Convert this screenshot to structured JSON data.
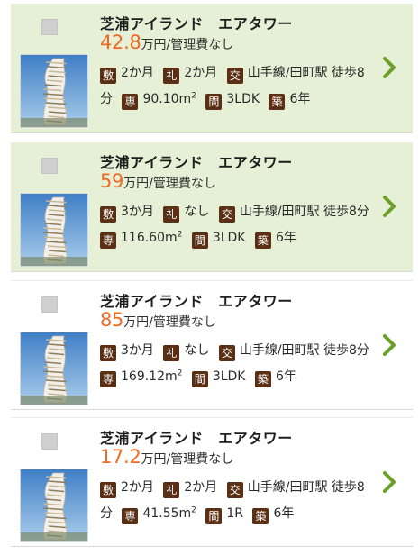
{
  "colors": {
    "price": "#ef6a24",
    "tag_bg": "#5a2f14",
    "chevron": "#6aa028",
    "highlight_bg": "#e6f0d6"
  },
  "listings": [
    {
      "title": "芝浦アイランド　エアタワー",
      "price": "42.8",
      "unit_fee": "万円/管理費なし",
      "tags": {
        "deposit": "敷",
        "key_money": "礼",
        "access": "交",
        "area": "専",
        "layout": "間",
        "age": "築"
      },
      "deposit": "2か月",
      "key_money": "2か月",
      "access": "山手線/田町駅 徒歩8分",
      "area": "90.10m",
      "area_sup": "2",
      "layout": "3LDK",
      "age": "6年",
      "icons": {
        "checkbox": "checkbox-icon",
        "thumb": "building-photo",
        "chevron": "chevron-right-icon"
      }
    },
    {
      "title": "芝浦アイランド　エアタワー",
      "price": "59",
      "unit_fee": "万円/管理費なし",
      "tags": {
        "deposit": "敷",
        "key_money": "礼",
        "access": "交",
        "area": "専",
        "layout": "間",
        "age": "築"
      },
      "deposit": "3か月",
      "key_money": "なし",
      "access": "山手線/田町駅 徒歩8分",
      "area": "116.60m",
      "area_sup": "2",
      "layout": "3LDK",
      "age": "6年",
      "icons": {
        "checkbox": "checkbox-icon",
        "thumb": "building-photo",
        "chevron": "chevron-right-icon"
      }
    },
    {
      "title": "芝浦アイランド　エアタワー",
      "price": "85",
      "unit_fee": "万円/管理費なし",
      "tags": {
        "deposit": "敷",
        "key_money": "礼",
        "access": "交",
        "area": "専",
        "layout": "間",
        "age": "築"
      },
      "deposit": "3か月",
      "key_money": "なし",
      "access": "山手線/田町駅 徒歩8分",
      "area": "169.12m",
      "area_sup": "2",
      "layout": "3LDK",
      "age": "6年",
      "icons": {
        "checkbox": "checkbox-icon",
        "thumb": "building-photo",
        "chevron": "chevron-right-icon"
      }
    },
    {
      "title": "芝浦アイランド　エアタワー",
      "price": "17.2",
      "unit_fee": "万円/管理費なし",
      "tags": {
        "deposit": "敷",
        "key_money": "礼",
        "access": "交",
        "area": "専",
        "layout": "間",
        "age": "築"
      },
      "deposit": "2か月",
      "key_money": "2か月",
      "access": "山手線/田町駅 徒歩8分",
      "area": "41.55m",
      "area_sup": "2",
      "layout": "1R",
      "age": "6年",
      "icons": {
        "checkbox": "checkbox-icon",
        "thumb": "building-photo",
        "chevron": "chevron-right-icon"
      }
    }
  ]
}
